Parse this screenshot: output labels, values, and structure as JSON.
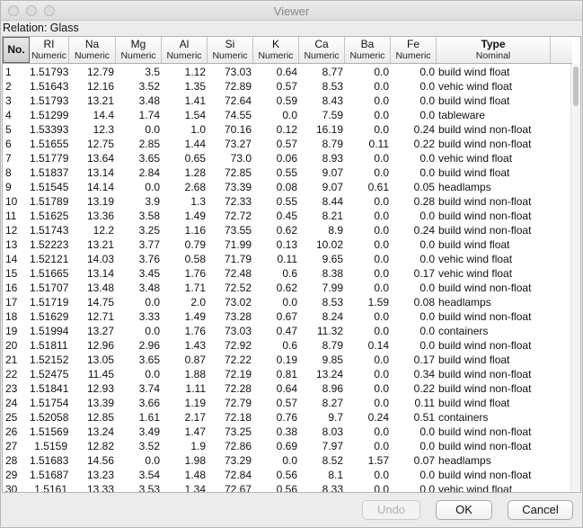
{
  "window": {
    "title": "Viewer"
  },
  "relation": "Relation: Glass",
  "columns": [
    {
      "name": "No.",
      "type": ""
    },
    {
      "name": "RI",
      "type": "Numeric"
    },
    {
      "name": "Na",
      "type": "Numeric"
    },
    {
      "name": "Mg",
      "type": "Numeric"
    },
    {
      "name": "Al",
      "type": "Numeric"
    },
    {
      "name": "Si",
      "type": "Numeric"
    },
    {
      "name": "K",
      "type": "Numeric"
    },
    {
      "name": "Ca",
      "type": "Numeric"
    },
    {
      "name": "Ba",
      "type": "Numeric"
    },
    {
      "name": "Fe",
      "type": "Numeric"
    },
    {
      "name": "Type",
      "type": "Nominal"
    }
  ],
  "rows": [
    [
      "1",
      "1.51793",
      "12.79",
      "3.5",
      "1.12",
      "73.03",
      "0.64",
      "8.77",
      "0.0",
      "0.0",
      "build wind float"
    ],
    [
      "2",
      "1.51643",
      "12.16",
      "3.52",
      "1.35",
      "72.89",
      "0.57",
      "8.53",
      "0.0",
      "0.0",
      "vehic wind float"
    ],
    [
      "3",
      "1.51793",
      "13.21",
      "3.48",
      "1.41",
      "72.64",
      "0.59",
      "8.43",
      "0.0",
      "0.0",
      "build wind float"
    ],
    [
      "4",
      "1.51299",
      "14.4",
      "1.74",
      "1.54",
      "74.55",
      "0.0",
      "7.59",
      "0.0",
      "0.0",
      "tableware"
    ],
    [
      "5",
      "1.53393",
      "12.3",
      "0.0",
      "1.0",
      "70.16",
      "0.12",
      "16.19",
      "0.0",
      "0.24",
      "build wind non-float"
    ],
    [
      "6",
      "1.51655",
      "12.75",
      "2.85",
      "1.44",
      "73.27",
      "0.57",
      "8.79",
      "0.11",
      "0.22",
      "build wind non-float"
    ],
    [
      "7",
      "1.51779",
      "13.64",
      "3.65",
      "0.65",
      "73.0",
      "0.06",
      "8.93",
      "0.0",
      "0.0",
      "vehic wind float"
    ],
    [
      "8",
      "1.51837",
      "13.14",
      "2.84",
      "1.28",
      "72.85",
      "0.55",
      "9.07",
      "0.0",
      "0.0",
      "build wind float"
    ],
    [
      "9",
      "1.51545",
      "14.14",
      "0.0",
      "2.68",
      "73.39",
      "0.08",
      "9.07",
      "0.61",
      "0.05",
      "headlamps"
    ],
    [
      "10",
      "1.51789",
      "13.19",
      "3.9",
      "1.3",
      "72.33",
      "0.55",
      "8.44",
      "0.0",
      "0.28",
      "build wind non-float"
    ],
    [
      "11",
      "1.51625",
      "13.36",
      "3.58",
      "1.49",
      "72.72",
      "0.45",
      "8.21",
      "0.0",
      "0.0",
      "build wind non-float"
    ],
    [
      "12",
      "1.51743",
      "12.2",
      "3.25",
      "1.16",
      "73.55",
      "0.62",
      "8.9",
      "0.0",
      "0.24",
      "build wind non-float"
    ],
    [
      "13",
      "1.52223",
      "13.21",
      "3.77",
      "0.79",
      "71.99",
      "0.13",
      "10.02",
      "0.0",
      "0.0",
      "build wind float"
    ],
    [
      "14",
      "1.52121",
      "14.03",
      "3.76",
      "0.58",
      "71.79",
      "0.11",
      "9.65",
      "0.0",
      "0.0",
      "vehic wind float"
    ],
    [
      "15",
      "1.51665",
      "13.14",
      "3.45",
      "1.76",
      "72.48",
      "0.6",
      "8.38",
      "0.0",
      "0.17",
      "vehic wind float"
    ],
    [
      "16",
      "1.51707",
      "13.48",
      "3.48",
      "1.71",
      "72.52",
      "0.62",
      "7.99",
      "0.0",
      "0.0",
      "build wind non-float"
    ],
    [
      "17",
      "1.51719",
      "14.75",
      "0.0",
      "2.0",
      "73.02",
      "0.0",
      "8.53",
      "1.59",
      "0.08",
      "headlamps"
    ],
    [
      "18",
      "1.51629",
      "12.71",
      "3.33",
      "1.49",
      "73.28",
      "0.67",
      "8.24",
      "0.0",
      "0.0",
      "build wind non-float"
    ],
    [
      "19",
      "1.51994",
      "13.27",
      "0.0",
      "1.76",
      "73.03",
      "0.47",
      "11.32",
      "0.0",
      "0.0",
      "containers"
    ],
    [
      "20",
      "1.51811",
      "12.96",
      "2.96",
      "1.43",
      "72.92",
      "0.6",
      "8.79",
      "0.14",
      "0.0",
      "build wind non-float"
    ],
    [
      "21",
      "1.52152",
      "13.05",
      "3.65",
      "0.87",
      "72.22",
      "0.19",
      "9.85",
      "0.0",
      "0.17",
      "build wind float"
    ],
    [
      "22",
      "1.52475",
      "11.45",
      "0.0",
      "1.88",
      "72.19",
      "0.81",
      "13.24",
      "0.0",
      "0.34",
      "build wind non-float"
    ],
    [
      "23",
      "1.51841",
      "12.93",
      "3.74",
      "1.11",
      "72.28",
      "0.64",
      "8.96",
      "0.0",
      "0.22",
      "build wind non-float"
    ],
    [
      "24",
      "1.51754",
      "13.39",
      "3.66",
      "1.19",
      "72.79",
      "0.57",
      "8.27",
      "0.0",
      "0.11",
      "build wind float"
    ],
    [
      "25",
      "1.52058",
      "12.85",
      "1.61",
      "2.17",
      "72.18",
      "0.76",
      "9.7",
      "0.24",
      "0.51",
      "containers"
    ],
    [
      "26",
      "1.51569",
      "13.24",
      "3.49",
      "1.47",
      "73.25",
      "0.38",
      "8.03",
      "0.0",
      "0.0",
      "build wind non-float"
    ],
    [
      "27",
      "1.5159",
      "12.82",
      "3.52",
      "1.9",
      "72.86",
      "0.69",
      "7.97",
      "0.0",
      "0.0",
      "build wind non-float"
    ],
    [
      "28",
      "1.51683",
      "14.56",
      "0.0",
      "1.98",
      "73.29",
      "0.0",
      "8.52",
      "1.57",
      "0.07",
      "headlamps"
    ],
    [
      "29",
      "1.51687",
      "13.23",
      "3.54",
      "1.48",
      "72.84",
      "0.56",
      "8.1",
      "0.0",
      "0.0",
      "build wind non-float"
    ],
    [
      "30",
      "1.5161",
      "13.33",
      "3.53",
      "1.34",
      "72.67",
      "0.56",
      "8.33",
      "0.0",
      "0.0",
      "vehic wind float"
    ]
  ],
  "buttons": {
    "undo": "Undo",
    "ok": "OK",
    "cancel": "Cancel"
  }
}
